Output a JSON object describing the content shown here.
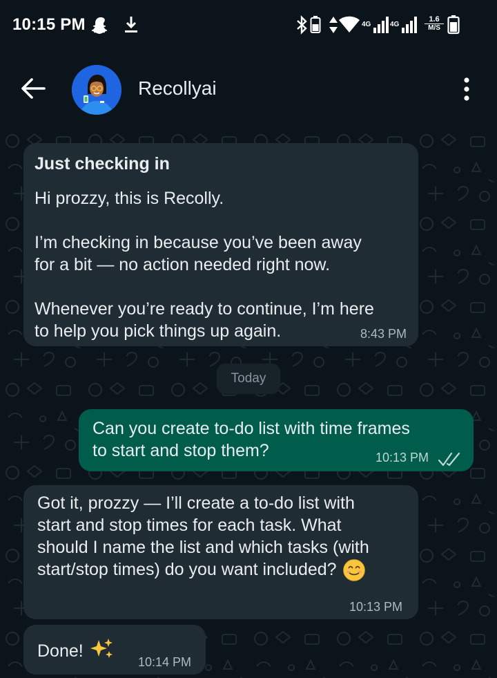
{
  "status_bar": {
    "time": "10:15 PM",
    "network_label_1": "4G",
    "network_label_2": "4G",
    "speed_value": "1.6",
    "speed_unit": "M/S",
    "icons": [
      "snapchat-icon",
      "download-icon",
      "bluetooth-icon",
      "battery-small-icon",
      "data-arrows-icon",
      "wifi-icon",
      "signal-icon",
      "signal-icon",
      "battery-icon"
    ]
  },
  "header": {
    "contact_name": "Recollyai",
    "back_icon": "arrow-left-icon",
    "menu_icon": "more-vertical-icon"
  },
  "messages": [
    {
      "direction": "incoming",
      "title": "Just checking in",
      "text": "Hi prozzy, this is Recolly.\n\nI’m checking in because you’ve been away\nfor a bit — no action needed right now.\n\nWhenever you’re ready to continue, I’m here\nto help you pick things up again.",
      "time": "8:43 PM"
    },
    {
      "direction": "outgoing",
      "text": "Can you create to-do list with time frames\nto start and stop them?",
      "time": "10:13 PM",
      "status_icon": "double-check-icon"
    },
    {
      "direction": "incoming",
      "text": "Got it, prozzy — I’ll create a to-do list with\nstart and stop times for each task. What\nshould I name the list and which tasks (with\nstart/stop times) do you want included?",
      "emoji": "smiling-face-icon",
      "time": "10:13 PM"
    },
    {
      "direction": "incoming",
      "text": "Done!",
      "emoji": "sparkles-icon",
      "time": "10:14 PM"
    }
  ],
  "date_divider": "Today",
  "colors": {
    "background": "#0b141a",
    "incoming_bubble": "#202c33",
    "outgoing_bubble": "#005c4b",
    "timestamp": "#aebac1"
  }
}
